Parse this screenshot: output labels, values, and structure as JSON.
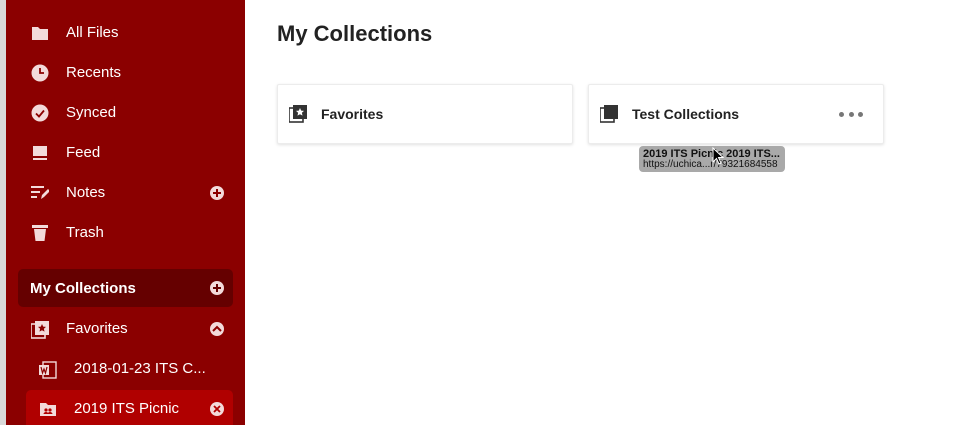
{
  "sidebar": {
    "nav": [
      {
        "label": "All Files",
        "icon": "folder-icon"
      },
      {
        "label": "Recents",
        "icon": "clock-icon"
      },
      {
        "label": "Synced",
        "icon": "check-circle-icon"
      },
      {
        "label": "Feed",
        "icon": "feed-icon"
      },
      {
        "label": "Notes",
        "icon": "notes-icon"
      },
      {
        "label": "Trash",
        "icon": "trash-icon"
      }
    ],
    "collections_header": "My Collections",
    "collections": [
      {
        "label": "Favorites",
        "icon": "star-stack-icon"
      },
      {
        "label": "2018-01-23 ITS C...",
        "icon": "word-doc-icon"
      },
      {
        "label": "2019 ITS Picnic",
        "icon": "shared-folder-icon"
      }
    ]
  },
  "main": {
    "title": "My Collections",
    "cards": [
      {
        "label": "Favorites",
        "icon": "star-stack-icon"
      },
      {
        "label": "Test Collections",
        "icon": "collection-icon"
      }
    ]
  },
  "tooltip": {
    "title": "2019 ITS Picnic 2019 ITS...",
    "url": "https://uchica...r/79321684558"
  },
  "colors": {
    "sidebar_bg": "#8b0000",
    "section_bg": "#650000",
    "active_bg": "#b00000"
  }
}
